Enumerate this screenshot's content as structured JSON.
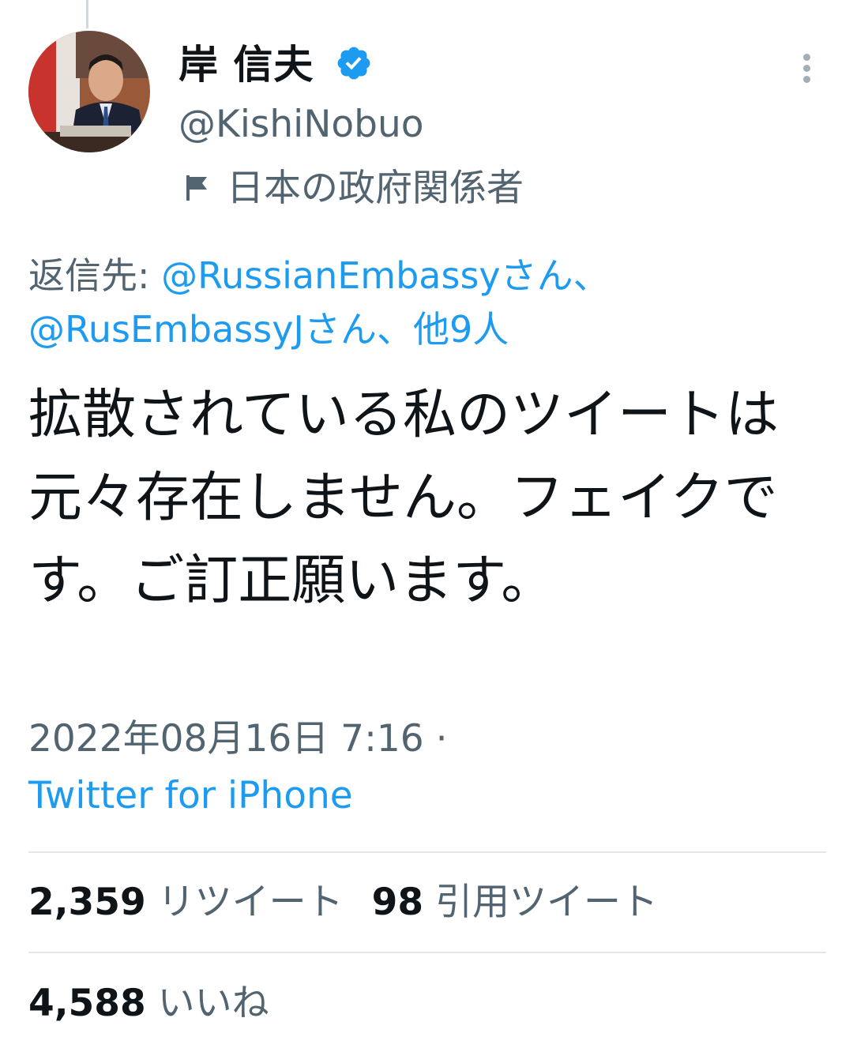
{
  "user": {
    "display_name": "岸 信夫",
    "handle": "@KishiNobuo",
    "label_icon": "flag-icon",
    "label": "日本の政府関係者",
    "verified": true,
    "verified_icon": "verified-badge-icon",
    "accent_color": "#1d9bf0"
  },
  "menu": {
    "icon": "more-vertical-icon"
  },
  "reply": {
    "prefix": "返信先:",
    "mention1": "@RussianEmbassyさん、",
    "mention2": "@RusEmbassyJさん、",
    "others": "他9人"
  },
  "tweet": {
    "text": "拡散されている私のツイートは元々存在しません。フェイクです。ご訂正願います。",
    "timestamp": "2022年08月16日 7:16 ·",
    "source": "Twitter for iPhone"
  },
  "stats": {
    "retweets_count": "2,359",
    "retweets_label": "リツイート",
    "quotes_count": "98",
    "quotes_label": "引用ツイート",
    "likes_count": "4,588",
    "likes_label": "いいね"
  }
}
